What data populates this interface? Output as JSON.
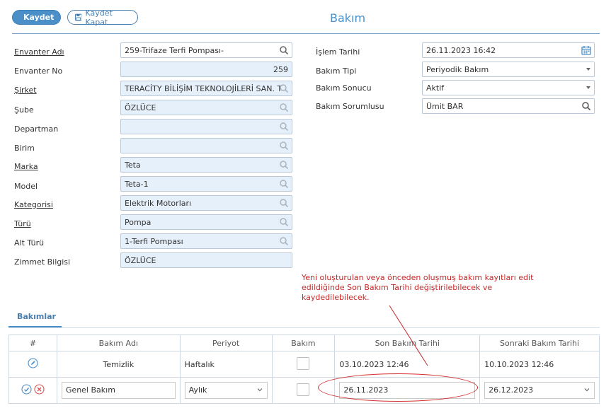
{
  "toolbar": {
    "save_label": "Kaydet",
    "save_close_label": "Kaydet Kapat"
  },
  "page": {
    "title": "Bakım"
  },
  "form_left": [
    {
      "label": "Envanter Adı",
      "underlined": true,
      "value": "259-Trifaze Terfi Pompası-",
      "style": "white-search"
    },
    {
      "label": "Envanter No",
      "underlined": false,
      "value": "259",
      "style": "number"
    },
    {
      "label": "Şirket",
      "underlined": true,
      "value": "TERACİTY BİLİŞİM TEKNOLOJİLERİ SAN. T",
      "style": "search"
    },
    {
      "label": "Şube",
      "underlined": false,
      "value": "ÖZLÜCE",
      "style": "search"
    },
    {
      "label": "Departman",
      "underlined": false,
      "value": "",
      "style": "search"
    },
    {
      "label": "Birim",
      "underlined": false,
      "value": "",
      "style": "search"
    },
    {
      "label": "Marka",
      "underlined": true,
      "value": "Teta",
      "style": "search"
    },
    {
      "label": "Model",
      "underlined": false,
      "value": "Teta-1",
      "style": "search"
    },
    {
      "label": "Kategorisi",
      "underlined": true,
      "value": "Elektrik Motorları",
      "style": "search"
    },
    {
      "label": "Türü",
      "underlined": true,
      "value": "Pompa",
      "style": "search"
    },
    {
      "label": "Alt Türü",
      "underlined": false,
      "value": "1-Terfi Pompası",
      "style": "search"
    },
    {
      "label": "Zimmet Bilgisi",
      "underlined": false,
      "value": "ÖZLÜCE",
      "style": "plain"
    }
  ],
  "form_right": {
    "islem_tarihi": {
      "label": "İşlem Tarihi",
      "value": "26.11.2023 16:42"
    },
    "bakim_tipi": {
      "label": "Bakım Tipi",
      "value": "Periyodik Bakım"
    },
    "bakim_sonucu": {
      "label": "Bakım Sonucu",
      "value": "Aktif"
    },
    "bakim_sorumlusu": {
      "label": "Bakım Sorumlusu",
      "value": "Ümit BAR"
    }
  },
  "annotation": {
    "note": "Yeni oluşturulan veya önceden oluşmuş bakım kayıtları edit edildiğinde Son Bakım Tarihi değiştirilebilecek ve kaydedilebilecek."
  },
  "tabs": {
    "bakimlar": "Bakımlar"
  },
  "table": {
    "headers": [
      "#",
      "Bakım Adı",
      "Periyot",
      "Bakım",
      "Son Bakım Tarihi",
      "Sonraki Bakım Tarihi"
    ],
    "rows": [
      {
        "name": "Temizlik",
        "periyot": "Haftalık",
        "son": "03.10.2023 12:46",
        "sonraki": "10.10.2023 12:46"
      },
      {
        "name": "Genel Bakım",
        "periyot": "Aylık",
        "son": "26.11.2023",
        "sonraki": "26.12.2023"
      }
    ]
  },
  "colors": {
    "accent": "#4a8fc8",
    "annotation": "#c62828",
    "field_bg": "#e6f0fa"
  }
}
